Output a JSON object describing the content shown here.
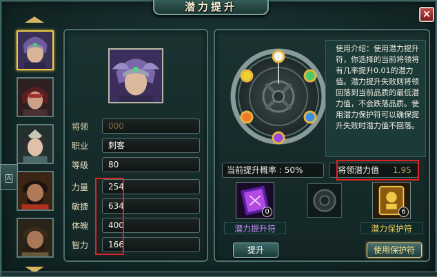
{
  "window": {
    "title": "潜力提升",
    "close_label": "×"
  },
  "side_tab": {
    "glyph": "A"
  },
  "hero": {
    "stats": [
      {
        "label": "将领",
        "value": "000",
        "placeholder": true
      },
      {
        "label": "职业",
        "value": "刺客"
      },
      {
        "label": "等级",
        "value": "80"
      },
      {
        "label": "力量",
        "value": "254"
      },
      {
        "label": "敏捷",
        "value": "634"
      },
      {
        "label": "体魄",
        "value": "400"
      },
      {
        "label": "智力",
        "value": "166"
      }
    ]
  },
  "info_text": "使用介绍：使用潜力提升符，你选择的当前将领将有几率提升0.01的潜力值。潜力提升失败则将领回落到当前品质的最低潜力值，不会跌落品质。使用潜力保护符可以确保提升失败时潜力值不回落。",
  "upgrade": {
    "rate_label": "当前提升概率 :",
    "rate_value": "50%",
    "potential_label": "将领潜力值",
    "potential_value": "1.95"
  },
  "items": {
    "boost": {
      "name": "潜力提升符",
      "count": "0"
    },
    "protect": {
      "name": "潜力保护符",
      "count": "6"
    }
  },
  "buttons": {
    "upgrade": "提升",
    "use_protect": "使用保护符"
  },
  "colors": {
    "highlight": "#e02424",
    "selected_portrait": "#f0c948",
    "boost_item_name": "#c58af0",
    "protect_item_name": "#f0cf55"
  }
}
